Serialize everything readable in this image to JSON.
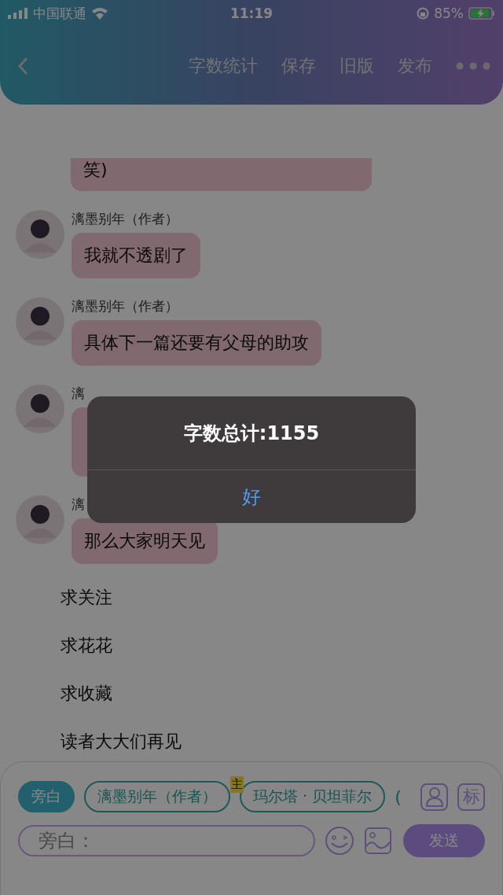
{
  "status_bar": {
    "carrier": "中国联通",
    "time": "11:19",
    "battery": "85%"
  },
  "nav": {
    "actions": [
      "字数统计",
      "保存",
      "旧版",
      "发布"
    ]
  },
  "messages": [
    {
      "kind": "continued",
      "text": "笑)"
    },
    {
      "kind": "message",
      "sender": "漓墨别年（作者）",
      "text": "我就不透剧了"
    },
    {
      "kind": "message",
      "sender": "漓墨别年（作者）",
      "text": "具体下一篇还要有父母的助攻"
    },
    {
      "kind": "message",
      "sender": "漓"
    },
    {
      "kind": "message",
      "sender": "漓",
      "text": "那么大家明天见"
    },
    {
      "kind": "line",
      "text": "求关注"
    },
    {
      "kind": "line",
      "text": "求花花"
    },
    {
      "kind": "line",
      "text": "求收藏"
    },
    {
      "kind": "line",
      "text": "读者大大们再见"
    }
  ],
  "composer": {
    "roles": [
      {
        "label": "旁白",
        "selected": true
      },
      {
        "label": "漓墨别年（作者）",
        "selected": false
      },
      {
        "label": "玛尔塔 · 贝坦菲尔",
        "selected": false,
        "badge": "主"
      },
      {
        "label": "(",
        "selected": false
      }
    ],
    "tag_button": "标",
    "input": {
      "placeholder": "旁白："
    },
    "send": "发送"
  },
  "dialog": {
    "message": "字数总计:1155",
    "button": "好"
  }
}
